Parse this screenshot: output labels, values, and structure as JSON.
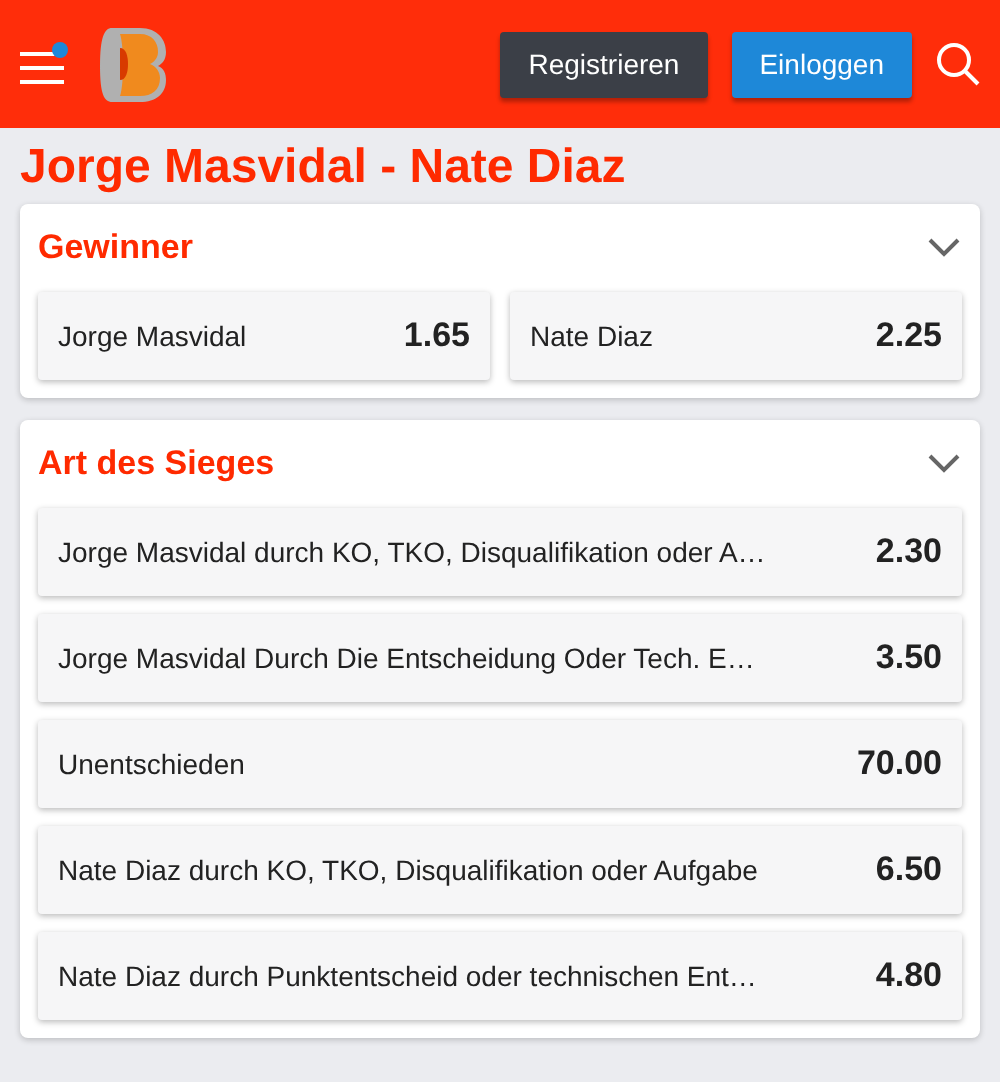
{
  "header": {
    "register_button": "Registrieren",
    "login_button": "Einloggen"
  },
  "title": "Jorge Masvidal - Nate Diaz",
  "markets": [
    {
      "title": "Gewinner",
      "expanded": true,
      "kind": "grid",
      "options": [
        {
          "label": "Jorge Masvidal",
          "odds": "1.65"
        },
        {
          "label": "Nate Diaz",
          "odds": "2.25"
        }
      ]
    },
    {
      "title": "Art des Sieges",
      "expanded": true,
      "kind": "list",
      "options": [
        {
          "label": "Jorge Masvidal durch KO, TKO, Disqualifikation oder A…",
          "odds": "2.30"
        },
        {
          "label": "Jorge Masvidal Durch Die Entscheidung Oder Tech. E…",
          "odds": "3.50"
        },
        {
          "label": "Unentschieden",
          "odds": "70.00"
        },
        {
          "label": "Nate Diaz durch KO, TKO, Disqualifikation oder Aufgabe",
          "odds": "6.50"
        },
        {
          "label": "Nate Diaz durch Punktentscheid oder technischen Ent…",
          "odds": "4.80"
        }
      ]
    }
  ]
}
